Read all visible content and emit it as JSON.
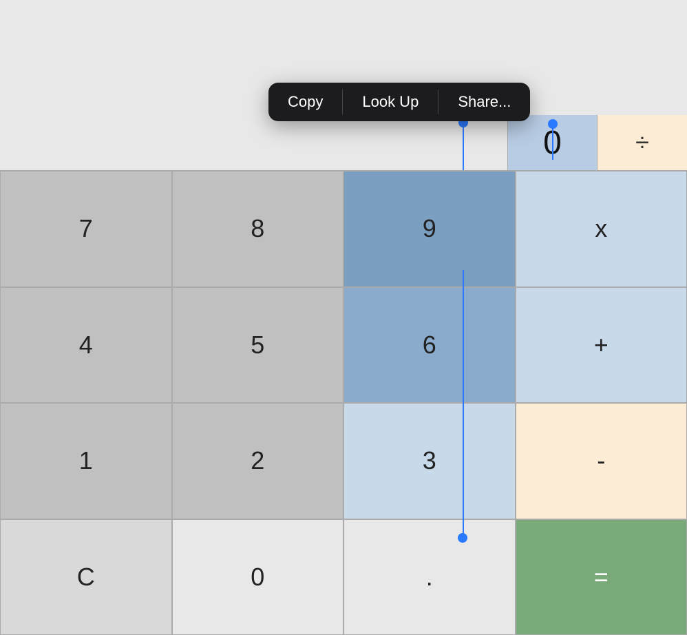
{
  "contextMenu": {
    "items": [
      {
        "id": "copy",
        "label": "Copy"
      },
      {
        "id": "lookup",
        "label": "Look Up"
      },
      {
        "id": "share",
        "label": "Share..."
      }
    ]
  },
  "display": {
    "mainValue": "",
    "highlightedValue": "0",
    "operator": "÷"
  },
  "keys": {
    "row1": [
      {
        "id": "7",
        "label": "7",
        "type": "num"
      },
      {
        "id": "8",
        "label": "8",
        "type": "num"
      },
      {
        "id": "9",
        "label": "9",
        "type": "num-highlight"
      },
      {
        "id": "multiply",
        "label": "x",
        "type": "op-highlight"
      }
    ],
    "row2": [
      {
        "id": "4",
        "label": "4",
        "type": "num"
      },
      {
        "id": "5",
        "label": "5",
        "type": "num"
      },
      {
        "id": "6",
        "label": "6",
        "type": "num-6"
      },
      {
        "id": "plus",
        "label": "+",
        "type": "op-highlight"
      }
    ],
    "row3": [
      {
        "id": "1",
        "label": "1",
        "type": "num"
      },
      {
        "id": "2",
        "label": "2",
        "type": "num"
      },
      {
        "id": "3",
        "label": "3",
        "type": "num-3"
      },
      {
        "id": "minus",
        "label": "-",
        "type": "op"
      }
    ],
    "row4": [
      {
        "id": "clear",
        "label": "C",
        "type": "clear"
      },
      {
        "id": "0",
        "label": "0",
        "type": "zero"
      },
      {
        "id": "dot",
        "label": ".",
        "type": "dot"
      },
      {
        "id": "equals",
        "label": "=",
        "type": "equals"
      }
    ]
  },
  "colors": {
    "numKey": "#c0c0c0",
    "numHighlight": "#8aabcc",
    "opKey": "#fdecd5",
    "opHighlight": "#c8d9ea",
    "equalsKey": "#7aaa7a",
    "accent": "#2a7aff",
    "menuBg": "#1c1c1e"
  }
}
